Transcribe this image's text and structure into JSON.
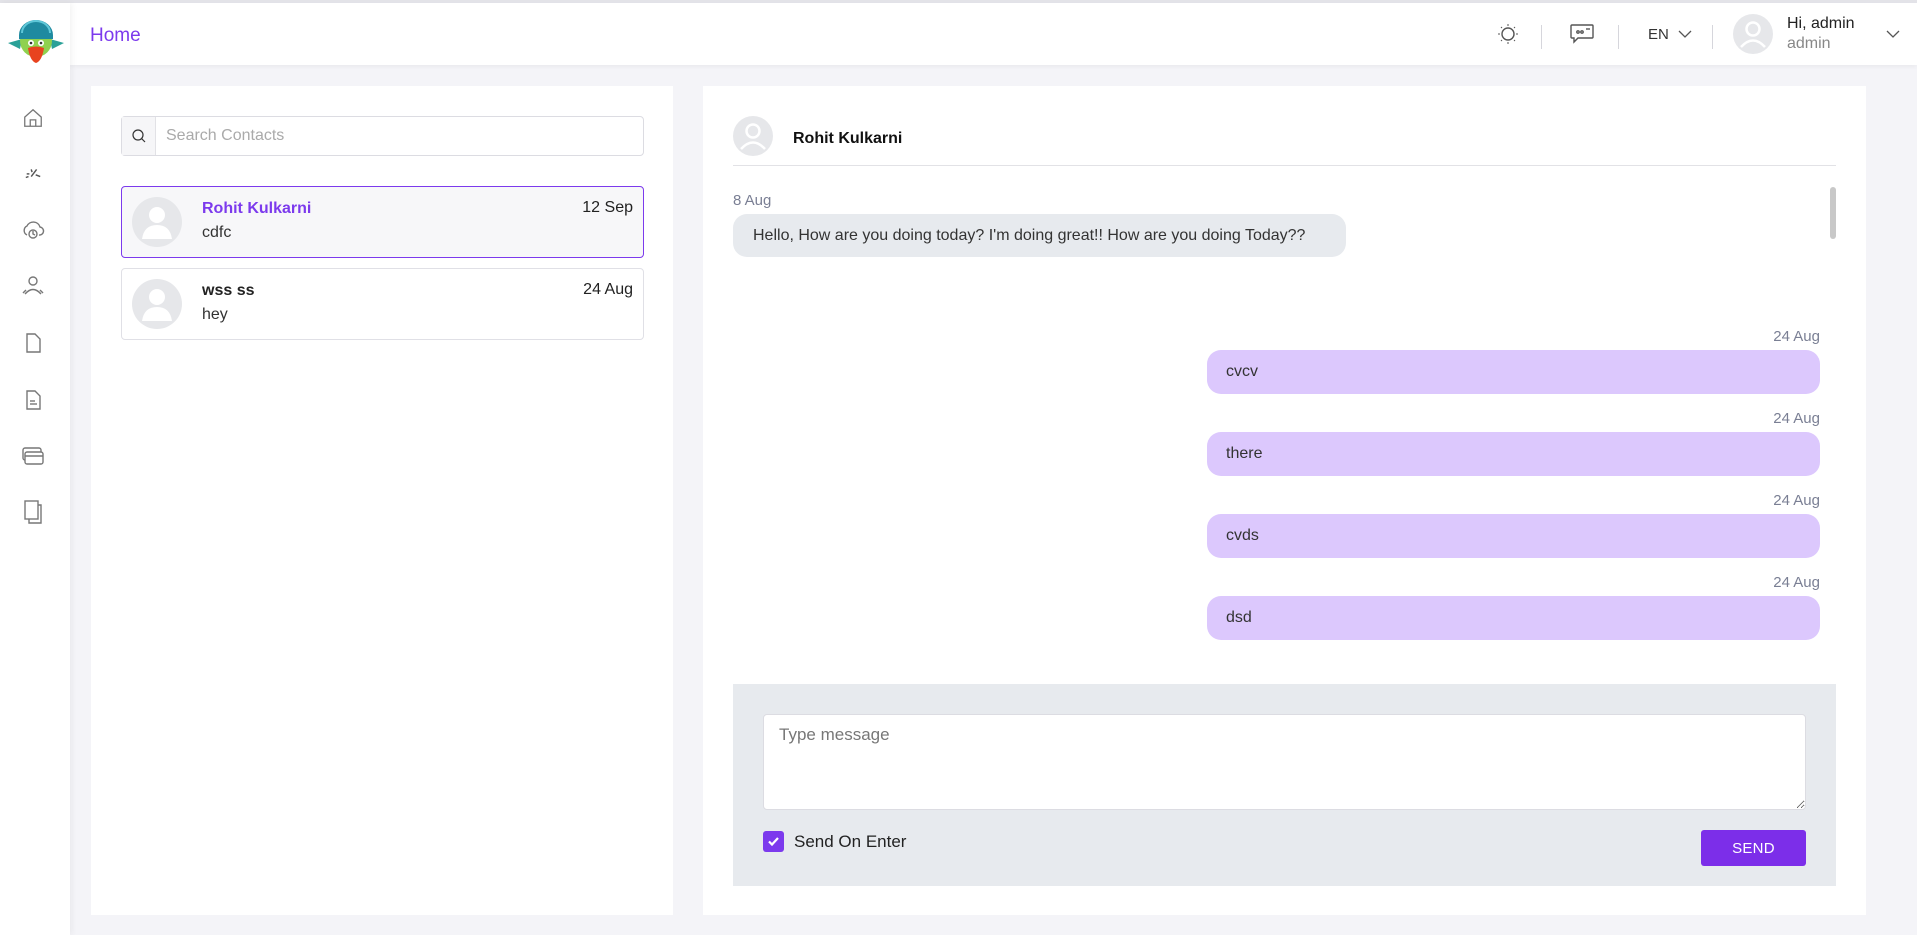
{
  "header": {
    "home_label": "Home",
    "theme_icon": "sun-icon",
    "chat_icon": "chat-bubble-icon",
    "language": "EN",
    "user_greeting": "Hi, admin",
    "user_role": "admin"
  },
  "sidebar": {
    "logo": "parrot-mascot-logo",
    "items": [
      {
        "name": "home",
        "icon": "home-icon"
      },
      {
        "name": "tools",
        "icon": "sparkle-tools-icon"
      },
      {
        "name": "cloud",
        "icon": "cloud-sync-icon"
      },
      {
        "name": "users",
        "icon": "user-group-icon"
      },
      {
        "name": "document",
        "icon": "file-icon"
      },
      {
        "name": "report",
        "icon": "file-text-icon"
      },
      {
        "name": "payments",
        "icon": "credit-card-icon"
      },
      {
        "name": "copies",
        "icon": "copy-icon"
      }
    ]
  },
  "contacts": {
    "search_placeholder": "Search Contacts",
    "search_value": "",
    "list": [
      {
        "name": "Rohit Kulkarni",
        "last_message": "cdfc",
        "date": "12 Sep",
        "active": true
      },
      {
        "name": "wss ss",
        "last_message": "hey",
        "date": "24 Aug",
        "active": false
      }
    ]
  },
  "chat": {
    "contact_name": "Rohit Kulkarni",
    "incoming": {
      "date": "8 Aug",
      "text": "Hello, How are you doing today? I'm doing great!! How are you doing Today??"
    },
    "outgoing": [
      {
        "date": "24 Aug",
        "text": "cvcv"
      },
      {
        "date": "24 Aug",
        "text": "there"
      },
      {
        "date": "24 Aug",
        "text": "cvds"
      },
      {
        "date": "24 Aug",
        "text": "dsd"
      }
    ],
    "composer": {
      "placeholder": "Type message",
      "value": "",
      "send_on_enter_label": "Send On Enter",
      "send_on_enter_checked": true,
      "send_label": "SEND"
    }
  },
  "colors": {
    "accent": "#7c3aed",
    "outgoing_bubble": "#dcc8fd",
    "incoming_bubble": "#e7eaee"
  }
}
